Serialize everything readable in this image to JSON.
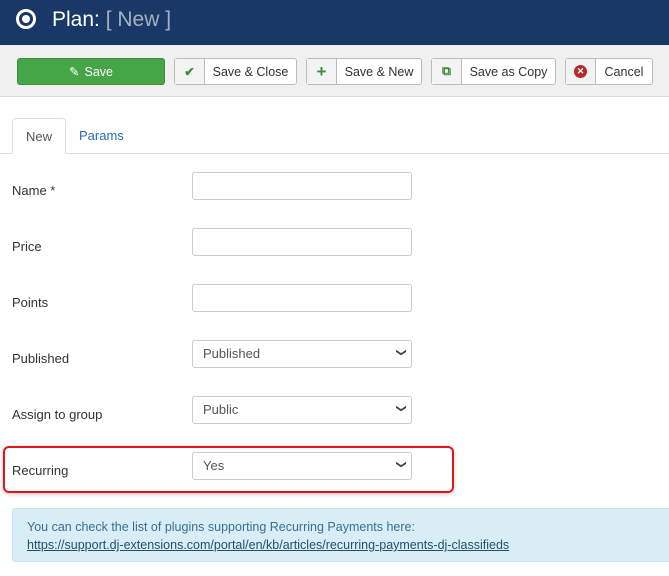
{
  "header": {
    "title": "Plan:",
    "subtitle": "[ New ]"
  },
  "toolbar": {
    "save": "Save",
    "save_close": "Save & Close",
    "save_new": "Save & New",
    "save_copy": "Save as Copy",
    "cancel": "Cancel"
  },
  "tabs": [
    {
      "label": "New",
      "active": true
    },
    {
      "label": "Params",
      "active": false
    }
  ],
  "form": {
    "name_label": "Name *",
    "name_value": "",
    "price_label": "Price",
    "price_value": "",
    "points_label": "Points",
    "points_value": "",
    "published_label": "Published",
    "published_value": "Published",
    "group_label": "Assign to group",
    "group_value": "Public",
    "recurring_label": "Recurring",
    "recurring_value": "Yes"
  },
  "info": {
    "text": "You can check the list of plugins supporting Recurring Payments here:",
    "link": "https://support.dj-extensions.com/portal/en/kb/articles/recurring-payments-dj-classifieds"
  },
  "colors": {
    "header": "#1a3867",
    "save": "#46a546",
    "highlight": "#e0161d",
    "info_bg": "#d9edf7"
  }
}
